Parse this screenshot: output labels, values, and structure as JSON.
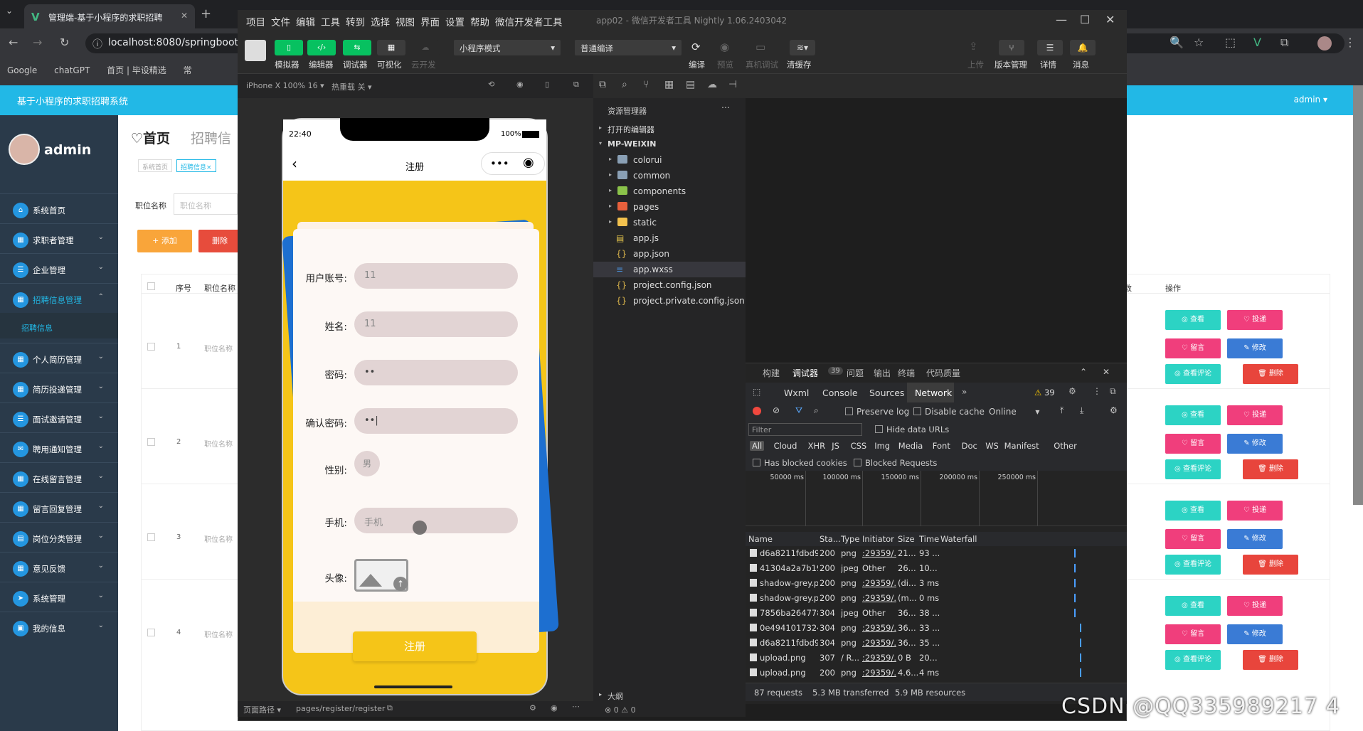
{
  "browser": {
    "tab_title": "管理端-基于小程序的求职招聘",
    "url": "localhost:8080/springboot",
    "bookmarks": [
      "Google",
      "chatGPT",
      "首页 | 毕设精选",
      "常"
    ]
  },
  "webapp": {
    "header_title": "基于小程序的求职招聘系统",
    "user_menu": "admin ▾",
    "username": "admin",
    "menu": [
      {
        "label": "系统首页",
        "icon": "home-icon"
      },
      {
        "label": "求职者管理",
        "icon": "grid-icon"
      },
      {
        "label": "企业管理",
        "icon": "list-icon"
      },
      {
        "label": "招聘信息管理",
        "icon": "grid-icon",
        "active": true
      },
      {
        "label": "个人简历管理",
        "icon": "grid-icon"
      },
      {
        "label": "简历投递管理",
        "icon": "grid-icon"
      },
      {
        "label": "面试邀请管理",
        "icon": "list-icon"
      },
      {
        "label": "聘用通知管理",
        "icon": "chat-icon"
      },
      {
        "label": "在线留言管理",
        "icon": "grid-icon"
      },
      {
        "label": "留言回复管理",
        "icon": "grid-icon"
      },
      {
        "label": "岗位分类管理",
        "icon": "book-icon"
      },
      {
        "label": "意见反馈",
        "icon": "grid-icon"
      },
      {
        "label": "系统管理",
        "icon": "send-icon"
      },
      {
        "label": "我的信息",
        "icon": "card-icon"
      }
    ],
    "submenu_item": "招聘信息",
    "page_title": "♡首页",
    "breadcrumb": "招聘信",
    "crumb_tags": [
      "系统首页",
      "招聘信息×"
    ],
    "search_label": "职位名称",
    "search_placeholder": "职位名称",
    "add_label": "+ 添加",
    "delete_label": "删除",
    "table_headers": {
      "seq": "序号",
      "pos": "职位名称",
      "extra": "数",
      "op": "操作"
    },
    "rows": [
      {
        "num": "1",
        "pos": "职位名称"
      },
      {
        "num": "2",
        "pos": "职位名称"
      },
      {
        "num": "3",
        "pos": "职位名称"
      },
      {
        "num": "4",
        "pos": "职位名称"
      }
    ],
    "actions": {
      "view": "◎ 查看",
      "apply": "♡ 投递",
      "msg": "♡ 留言",
      "edit": "✎ 修改",
      "comments": "◎ 查看评论",
      "del": "🗑 删除"
    }
  },
  "devtool": {
    "menu": [
      "项目",
      "文件",
      "编辑",
      "工具",
      "转到",
      "选择",
      "视图",
      "界面",
      "设置",
      "帮助",
      "微信开发者工具"
    ],
    "title": "app02 - 微信开发者工具 Nightly 1.06.2403042",
    "toolbar": {
      "simulator": "模拟器",
      "editor": "编辑器",
      "debugger": "调试器",
      "visual": "可视化",
      "cloud": "云开发",
      "mode": "小程序模式",
      "compile_mode": "普通编译",
      "compile": "编译",
      "preview": "预览",
      "real_debug": "真机调试",
      "clear_cache": "清缓存",
      "upload": "上传",
      "version": "版本管理",
      "detail": "详情",
      "message": "消息"
    },
    "sim_device": "iPhone X 100% 16 ▾",
    "hot_reload": "热重载 关 ▾",
    "phone": {
      "time": "22:40",
      "battery": "100%",
      "nav_title": "注册",
      "fields": [
        {
          "label": "用户账号:",
          "value": "11"
        },
        {
          "label": "姓名:",
          "value": "11"
        },
        {
          "label": "密码:",
          "value": "••"
        },
        {
          "label": "确认密码:",
          "value": "••|"
        }
      ],
      "gender_label": "性别:",
      "gender_value": "男",
      "phone_label": "手机:",
      "phone_placeholder": "手机",
      "avatar_label": "头像:",
      "register_button": "注册"
    },
    "page_path_label": "页面路径 ▾",
    "page_path": "pages/register/register",
    "explorer": {
      "title": "资源管理器",
      "open_editors": "打开的编辑器",
      "root": "MP-WEIXIN",
      "items": [
        {
          "name": "colorui",
          "type": "folder"
        },
        {
          "name": "common",
          "type": "folder"
        },
        {
          "name": "components",
          "type": "folder"
        },
        {
          "name": "pages",
          "type": "folder"
        },
        {
          "name": "static",
          "type": "folder"
        },
        {
          "name": "app.js",
          "type": "js"
        },
        {
          "name": "app.json",
          "type": "json"
        },
        {
          "name": "app.wxss",
          "type": "wxss"
        },
        {
          "name": "project.config.json",
          "type": "json"
        },
        {
          "name": "project.private.config.json",
          "type": "json"
        }
      ],
      "outline": "大纲"
    },
    "debugger": {
      "top_tabs": [
        "构建",
        "调试器",
        "问题",
        "输出",
        "终端",
        "代码质量"
      ],
      "badge": "39",
      "tabs": [
        "Wxml",
        "Console",
        "Sources",
        "Network"
      ],
      "warn_count": "39",
      "preserve_log": "Preserve log",
      "disable_cache": "Disable cache",
      "throttle": "Online",
      "filter_placeholder": "Filter",
      "hide_data_urls": "Hide data URLs",
      "types": [
        "All",
        "Cloud",
        "XHR",
        "JS",
        "CSS",
        "Img",
        "Media",
        "Font",
        "Doc",
        "WS",
        "Manifest",
        "Other"
      ],
      "has_blocked": "Has blocked cookies",
      "blocked_requests": "Blocked Requests",
      "timeline_ticks": [
        "50000 ms",
        "100000 ms",
        "150000 ms",
        "200000 ms",
        "250000 ms"
      ],
      "columns": [
        "Name",
        "Sta...",
        "Type",
        "Initiator",
        "Size",
        "Time",
        "Waterfall"
      ],
      "requests": [
        {
          "name": "d6a8211fdbd94...",
          "status": "200",
          "type": "png",
          "init": ":29359/...",
          "size": "21...",
          "time": "93 ..."
        },
        {
          "name": "41304a2a7b194...",
          "status": "200",
          "type": "jpeg",
          "init": "Other",
          "size": "26...",
          "time": "10..."
        },
        {
          "name": "shadow-grey.png",
          "status": "200",
          "type": "png",
          "init": ":29359/...",
          "size": "(di...",
          "time": "3 ms"
        },
        {
          "name": "shadow-grey.png",
          "status": "200",
          "type": "png",
          "init": ":29359/...",
          "size": "(m...",
          "time": "0 ms"
        },
        {
          "name": "7856ba2647784...",
          "status": "304",
          "type": "jpeg",
          "init": "Other",
          "size": "36...",
          "time": "38 ..."
        },
        {
          "name": "0e49410173244...",
          "status": "304",
          "type": "png",
          "init": ":29359/...",
          "size": "36...",
          "time": "33 ..."
        },
        {
          "name": "d6a8211fdbd94...",
          "status": "304",
          "type": "png",
          "init": ":29359/...",
          "size": "36...",
          "time": "35 ..."
        },
        {
          "name": "upload.png",
          "status": "307",
          "type": "/ R...",
          "init": ":29359/...",
          "size": "0 B",
          "time": "20..."
        },
        {
          "name": "upload.png",
          "status": "200",
          "type": "png",
          "init": ":29359/...",
          "size": "4.6...",
          "time": "4 ms"
        }
      ],
      "footer": {
        "requests": "87 requests",
        "transferred": "5.3 MB transferred",
        "resources": "5.9 MB resources"
      }
    },
    "status_errors": "⊗ 0 ⚠ 0"
  },
  "watermark": "CSDN @QQ335989217 4"
}
